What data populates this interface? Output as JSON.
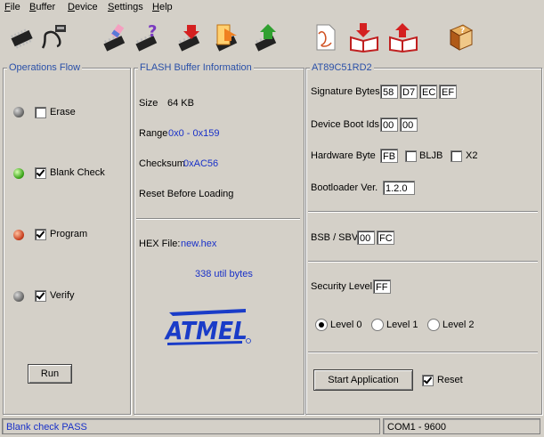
{
  "menu": {
    "file": {
      "underline": "F",
      "rest": "ile"
    },
    "buffer": {
      "underline": "B",
      "rest": "uffer"
    },
    "device": {
      "underline": "D",
      "rest": "evice"
    },
    "settings": {
      "underline": "S",
      "rest": "ettings"
    },
    "help": {
      "underline": "H",
      "rest": "elp"
    }
  },
  "toolbar": {
    "icons": [
      "select-device-chip-icon",
      "usb-cable-icon",
      "erase-chip-icon",
      "blank-check-chip-icon",
      "program-chip-icon",
      "read-chip-icon",
      "verify-chip-icon",
      "load-hex-document-icon",
      "save-hex-books-icon",
      "save-books-red-arrow-icon",
      "help-book-icon"
    ]
  },
  "operations": {
    "title": "Operations Flow",
    "steps": [
      {
        "label": "Erase",
        "checked": false,
        "led": "grey"
      },
      {
        "label": "Blank Check",
        "checked": true,
        "led": "green"
      },
      {
        "label": "Program",
        "checked": true,
        "led": "red"
      },
      {
        "label": "Verify",
        "checked": true,
        "led": "grey"
      }
    ],
    "run_label": "Run"
  },
  "flash": {
    "title": "FLASH Buffer Information",
    "size_label": "Size",
    "size_value": "64 KB",
    "range_label": "Range",
    "range_value": "0x0 - 0x159",
    "checksum_label": "Checksum",
    "checksum_value": "0xAC56",
    "reset_label": "Reset Before Loading",
    "hex_label": "HEX File:",
    "hex_value": "new.hex",
    "util_bytes": "338 util bytes",
    "logo_text": "ATMEL",
    "logo_color": "#1a3cc8"
  },
  "device": {
    "title": "AT89C51RD2",
    "signature_label": "Signature Bytes",
    "signature": [
      "58",
      "D7",
      "EC",
      "EF"
    ],
    "boot_ids_label": "Device Boot Ids",
    "boot_ids": [
      "00",
      "00"
    ],
    "hw_byte_label": "Hardware Byte",
    "hw_byte": "FB",
    "bljb_label": "BLJB",
    "x2_label": "X2",
    "bootloader_label": "Bootloader Ver.",
    "bootloader_value": "1.2.0",
    "bsb_label": "BSB / SBV",
    "bsb": "00",
    "sbv": "FC",
    "security_label": "Security Level",
    "security_value": "FF",
    "levels": [
      "Level 0",
      "Level 1",
      "Level 2"
    ],
    "selected_level": 0,
    "start_app_label": "Start Application",
    "reset_label": "Reset",
    "reset_checked": true
  },
  "status": {
    "message": "Blank check PASS",
    "port": "COM1 - 9600"
  }
}
